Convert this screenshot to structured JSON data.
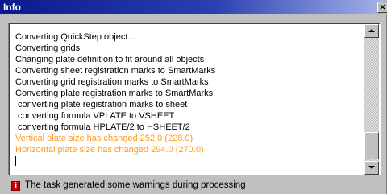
{
  "window": {
    "title": "Info",
    "close_glyph": "×"
  },
  "log": {
    "lines": [
      "Converting QuickStep object...",
      "Converting grids",
      "Changing plate definition to fit around all objects",
      "Converting sheet registration marks to SmartMarks",
      "Converting grid registration marks to SmartMarks",
      "Converting plate registration marks to SmartMarks",
      "converting plate registration marks to sheet",
      "converting formula VPLATE to VSHEET",
      "converting formula HPLATE/2 to HSHEET/2",
      "Vertical plate size has changed 252.0 (228.0)",
      "Horizontal plate size has changed 294.0 (270.0)"
    ],
    "warning_color": "#ff9a1f"
  },
  "status": {
    "icon": "warning-icon",
    "icon_glyph": "i",
    "text": "The task generated some warnings during processing"
  }
}
